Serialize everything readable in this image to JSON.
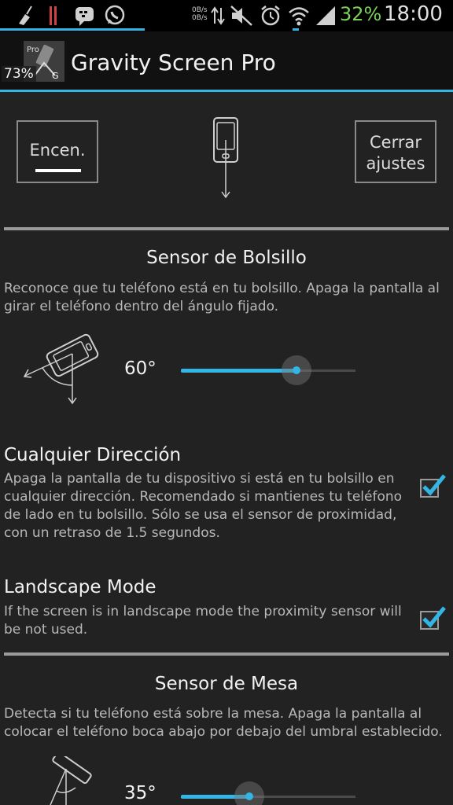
{
  "status_bar": {
    "net_up": "0B/s",
    "net_down": "0B/s",
    "battery": "32%",
    "time": "18:00",
    "icons": [
      "broom-icon",
      "sim-icon",
      "bbm-icon",
      "whatsapp-icon",
      "data-arrows-icon",
      "mute-icon",
      "alarm-icon",
      "wifi-icon",
      "signal-icon",
      "battery-icon"
    ]
  },
  "action_bar": {
    "title": "Gravity Screen Pro",
    "battery_badge": "73%",
    "icon": "gravity-screen-app-icon"
  },
  "controls": {
    "power_label": "Encen.",
    "close_label_line1": "Cerrar",
    "close_label_line2": "ajustes",
    "phone_icon": "phone-down-arrow-icon"
  },
  "pocket_sensor": {
    "title": "Sensor de Bolsillo",
    "desc_line1": "Reconoce que tu teléfono está en tu bolsillo. Apaga la pantalla al",
    "desc_line2": "girar el teléfono dentro del ángulo fijado.",
    "angle_label": "60°",
    "angle_value": 60,
    "slider_fraction": 0.66
  },
  "any_direction": {
    "title": "Cualquier Dirección",
    "desc_line1": "Apaga la pantalla de tu dispositivo si está en tu bolsillo en",
    "desc_line2": "cualquier dirección. Recomendado si mantienes tu teléfono",
    "desc_line3": "de lado en tu bolsillo. Sólo se usa el sensor de proximidad,",
    "desc_line4": "con un retraso de 1.5 segundos.",
    "checked": true
  },
  "landscape_mode": {
    "title": "Landscape Mode",
    "desc_line1": "If the screen is in landscape mode the proximity sensor will",
    "desc_line2": "be not used.",
    "checked": true
  },
  "table_sensor": {
    "title": "Sensor de Mesa",
    "desc_line1": "Detecta si tu teléfono está sobre la mesa. Apaga la pantalla al",
    "desc_line2": "colocar el teléfono boca abajo por debajo del umbral establecido.",
    "angle_label": "35°",
    "angle_value": 35,
    "slider_fraction": 0.39
  },
  "colors": {
    "accent": "#33b5e5",
    "background": "#222222",
    "battery_text": "#7cd15a"
  }
}
